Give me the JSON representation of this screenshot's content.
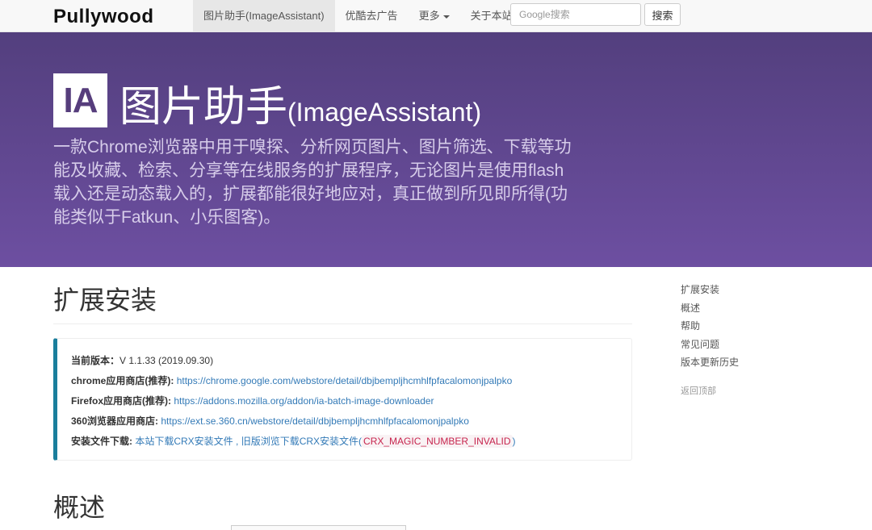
{
  "navbar": {
    "brand": "Pullywood",
    "items": [
      {
        "label": "图片助手(ImageAssistant)",
        "active": true
      },
      {
        "label": "优酷去广告",
        "active": false
      },
      {
        "label": "更多",
        "active": false,
        "dropdown": true
      },
      {
        "label": "关于本站",
        "active": false
      }
    ],
    "search_placeholder": "Google搜索",
    "search_button": "搜索"
  },
  "hero": {
    "logo_text": "IA",
    "title_cn": "图片助手",
    "title_en": "(ImageAssistant)",
    "description": "一款Chrome浏览器中用于嗅探、分析网页图片、图片筛选、下载等功能及收藏、检索、分享等在线服务的扩展程序，无论图片是使用flash载入还是动态载入的，扩展都能很好地应对，真正做到所见即所得(功能类似于Fatkun、小乐图客)。"
  },
  "install": {
    "heading": "扩展安装",
    "version_label": "当前版本：",
    "version_value": "V 1.1.33 (2019.09.30)",
    "chrome_label": "chrome应用商店(推荐):",
    "chrome_url": "https://chrome.google.com/webstore/detail/dbjbempljhcmhlfpfacalomonjpalpko",
    "firefox_label": "Firefox应用商店(推荐):",
    "firefox_url": "https://addons.mozilla.org/addon/ia-batch-image-downloader",
    "s360_label": "360浏览器应用商店:",
    "s360_url": "https://ext.se.360.cn/webstore/detail/dbjbempljhcmhlfpfacalomonjpalpko",
    "file_label": "安装文件下载:",
    "file_link1": "本站下载CRX安装文件",
    "file_sep": " , ",
    "file_link2": "旧版浏览下载CRX安装文件",
    "file_paren_open": "(",
    "file_code": "CRX_MAGIC_NUMBER_INVALID",
    "file_paren_close": ")"
  },
  "overview": {
    "heading": "概述"
  },
  "sidebar": {
    "links": [
      "扩展安装",
      "概述",
      "帮助",
      "常见问题",
      "版本更新历史"
    ],
    "back_to_top": "返回顶部"
  },
  "colors": {
    "hero_top": "#533f7e",
    "hero_bottom": "#6d4fa1",
    "link": "#337ab7",
    "callout_border": "#1a7e9c",
    "code_text": "#c7254e"
  }
}
